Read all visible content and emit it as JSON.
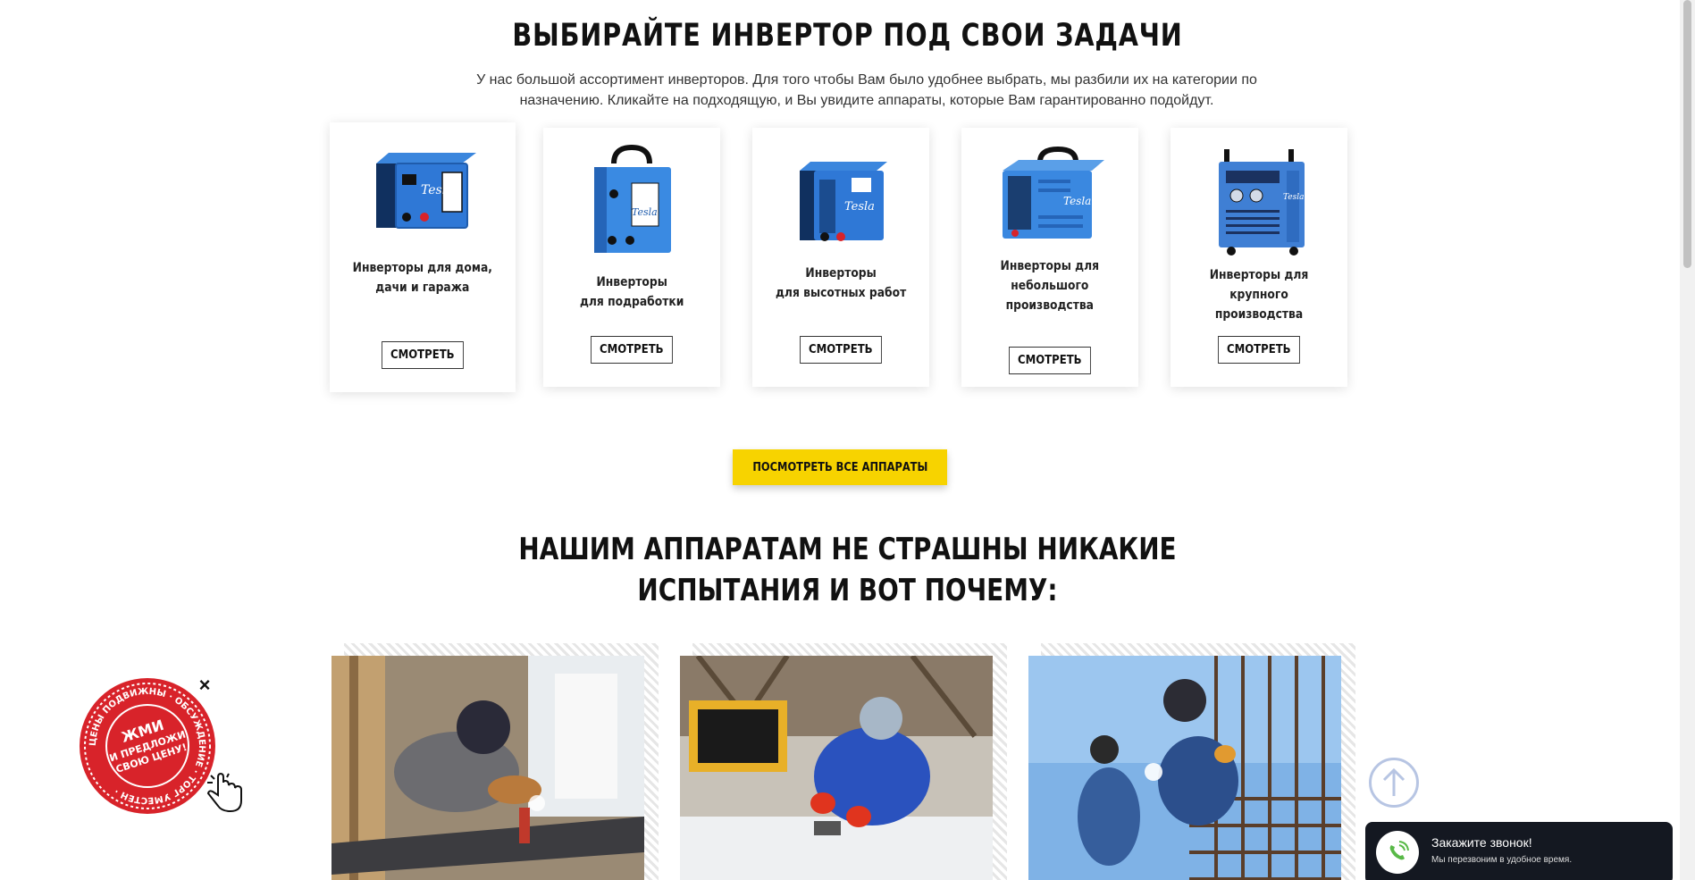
{
  "section1": {
    "title": "ВЫБИРАЙТЕ ИНВЕРТОР ПОД СВОИ ЗАДАЧИ",
    "subtitle_line1": "У нас большой ассортимент инверторов. Для того чтобы Вам было удобнее выбрать, мы разбили их на категории по",
    "subtitle_line2": "назначению. Кликайте на подходящую, и Вы увидите аппараты, которые Вам гарантированно подойдут."
  },
  "cards": [
    {
      "label_line1": "Инверторы для дома,",
      "label_line2": "дачи и гаража",
      "label_line3": "",
      "button": "СМОТРЕТЬ"
    },
    {
      "label_line1": "Инверторы",
      "label_line2": "для подработки",
      "label_line3": "",
      "button": "СМОТРЕТЬ"
    },
    {
      "label_line1": "Инверторы",
      "label_line2": "для высотных работ",
      "label_line3": "",
      "button": "СМОТРЕТЬ"
    },
    {
      "label_line1": "Инверторы для",
      "label_line2": "небольшого",
      "label_line3": "производства",
      "button": "СМОТРЕТЬ"
    },
    {
      "label_line1": "Инверторы для крупного",
      "label_line2": "производства",
      "label_line3": "",
      "button": "СМОТРЕТЬ"
    }
  ],
  "all_button": "ПОСМОТРЕТЬ ВСЕ АППАРАТЫ",
  "section2": {
    "title_line1": "НАШИМ АППАРАТАМ НЕ СТРАШНЫ НИКАКИЕ",
    "title_line2": "ИСПЫТАНИЯ И ВОТ ПОЧЕМУ:"
  },
  "promo": {
    "center_line1": "ЖМИ",
    "center_line2": "И ПРЕДЛОЖИ",
    "center_line3": "СВОЮ ЦЕНУ!",
    "ring_text": "ЦЕНЫ ПОДВИЖНЫ · ОБСУЖДЕНИЕ · ТОРГ УМЕСТЕН ·",
    "close": "×"
  },
  "callback": {
    "title": "Закажите звонок!",
    "subtitle": "Мы перезвоним в удобное время."
  },
  "colors": {
    "accent_yellow": "#f7d300",
    "product_blue": "#2f78d6",
    "promo_red": "#d8232a",
    "callback_bg": "#141821",
    "phone_green": "#58b947"
  }
}
